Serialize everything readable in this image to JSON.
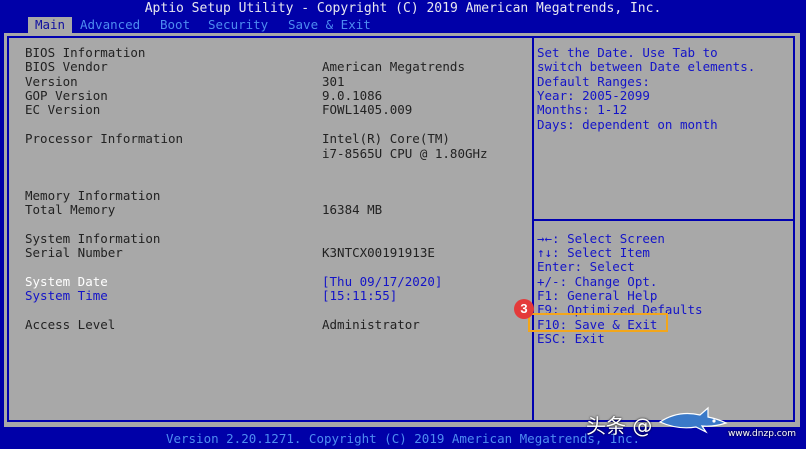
{
  "header": {
    "title": "Aptio Setup Utility - Copyright (C) 2019 American Megatrends, Inc."
  },
  "menu": {
    "tabs": [
      "Main",
      "Advanced",
      "Boot",
      "Security",
      "Save & Exit"
    ],
    "active": "Main"
  },
  "main": {
    "bios_info_label": "BIOS Information",
    "rows": [
      {
        "label": "BIOS Vendor",
        "value": "American Megatrends"
      },
      {
        "label": "Version",
        "value": "301"
      },
      {
        "label": "GOP Version",
        "value": "9.0.1086"
      },
      {
        "label": "EC Version",
        "value": "FOWL1405.009"
      }
    ],
    "processor_label": "Processor Information",
    "processor_line1": "Intel(R) Core(TM)",
    "processor_line2": "i7-8565U CPU @ 1.80GHz",
    "memory_info_label": "Memory Information",
    "total_memory_label": "Total Memory",
    "total_memory_value": "16384 MB",
    "system_info_label": "System Information",
    "serial_label": "Serial Number",
    "serial_value": "K3NTCX00191913E",
    "system_date_label": "System Date",
    "system_date_value": "[Thu 09/17/2020]",
    "system_time_label": "System Time",
    "system_time_value": "[15:11:55]",
    "access_level_label": "Access Level",
    "access_level_value": "Administrator"
  },
  "help": {
    "description": [
      "Set the Date. Use Tab to",
      "switch between Date elements.",
      "Default Ranges:",
      "Year: 2005-2099",
      "Months: 1-12",
      "Days: dependent on month"
    ],
    "keys": [
      "→←: Select Screen",
      "↑↓: Select Item",
      "Enter: Select",
      "+/-: Change Opt.",
      "F1: General Help",
      "F9: Optimized Defaults",
      "F10: Save & Exit",
      "ESC: Exit"
    ]
  },
  "annotation": {
    "badge_number": "3",
    "highlight_color": "#f3a61b"
  },
  "footer": {
    "text": "Version 2.20.1271. Copyright (C) 2019 American Megatrends, Inc."
  },
  "watermark": {
    "text": "头条 @",
    "site": "www.dnzp.com"
  }
}
